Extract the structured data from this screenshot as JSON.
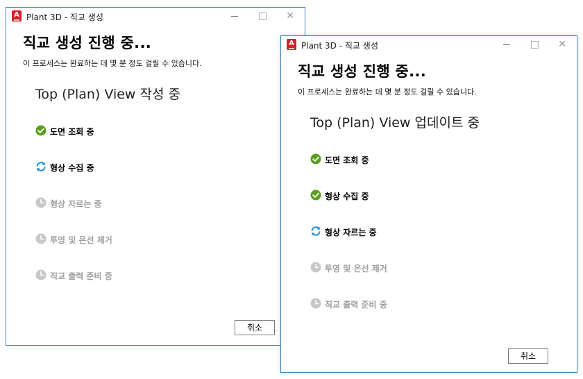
{
  "dialog": {
    "window_title": "Plant 3D - 직교 생성",
    "heading": "직교 생성 진행 중...",
    "subtitle": "이 프로세스는 완료하는 데 몇 분 정도 걸릴 수 있습니다.",
    "cancel_label": "취소",
    "app_icon_letter": "A",
    "window_controls": {
      "minimize": "minimize-icon",
      "maximize": "maximize-icon",
      "close": "close-icon"
    }
  },
  "windows": [
    {
      "stage": "Top (Plan) View 작성 중",
      "steps": [
        {
          "label": "도면 조회 중",
          "status": "done"
        },
        {
          "label": "형상 수집 중",
          "status": "in-progress"
        },
        {
          "label": "형상 자르는 중",
          "status": "pending"
        },
        {
          "label": "투영 및 은선 제거",
          "status": "pending"
        },
        {
          "label": "직교 출력 준비 중",
          "status": "pending"
        }
      ]
    },
    {
      "stage": "Top (Plan) View 업데이트 중",
      "steps": [
        {
          "label": "도면 조회 중",
          "status": "done"
        },
        {
          "label": "형상 수집 중",
          "status": "done"
        },
        {
          "label": "형상 자르는 중",
          "status": "in-progress"
        },
        {
          "label": "투영 및 은선 제거",
          "status": "pending"
        },
        {
          "label": "직교 출력 준비 중",
          "status": "pending"
        }
      ]
    }
  ],
  "colors": {
    "done": "#5a9e1f",
    "in_progress": "#1e88d6",
    "pending": "#c8c8c8",
    "border": "#3c7fb1",
    "app_icon": "#d2232a"
  },
  "icons": {
    "done": "check-circle-icon",
    "in-progress": "refresh-icon",
    "pending": "clock-icon"
  }
}
